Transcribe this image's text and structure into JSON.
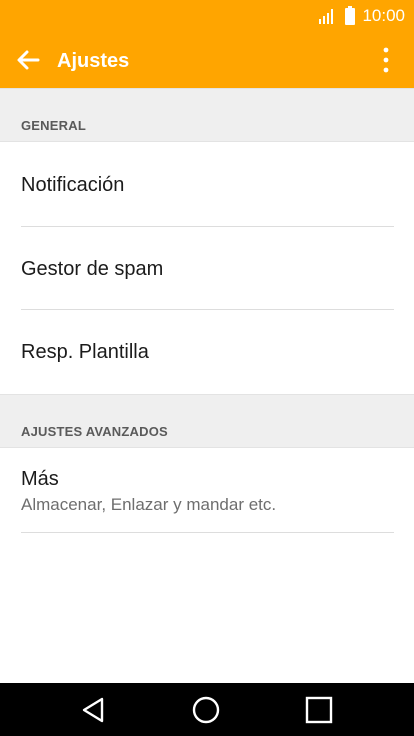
{
  "status_bar": {
    "time": "10:00",
    "signal_icon": "signal-icon",
    "battery_icon": "battery-icon"
  },
  "app_bar": {
    "title": "Ajustes",
    "back_icon": "arrow-back-icon",
    "menu_icon": "more-vert-icon"
  },
  "sections": {
    "general": {
      "header": "GENERAL",
      "items": [
        {
          "label": "Notificación"
        },
        {
          "label": "Gestor de spam"
        },
        {
          "label": "Resp. Plantilla"
        }
      ]
    },
    "advanced": {
      "header": "AJUSTES AVANZADOS",
      "items": [
        {
          "label": "Más",
          "summary": "Almacenar, Enlazar y mandar etc."
        }
      ]
    }
  },
  "nav_bar": {
    "back_icon": "triangle-back-icon",
    "home_icon": "circle-home-icon",
    "recents_icon": "square-recents-icon"
  },
  "colors": {
    "accent": "#ffa500",
    "section_background": "#efefef",
    "nav_background": "#000000"
  }
}
